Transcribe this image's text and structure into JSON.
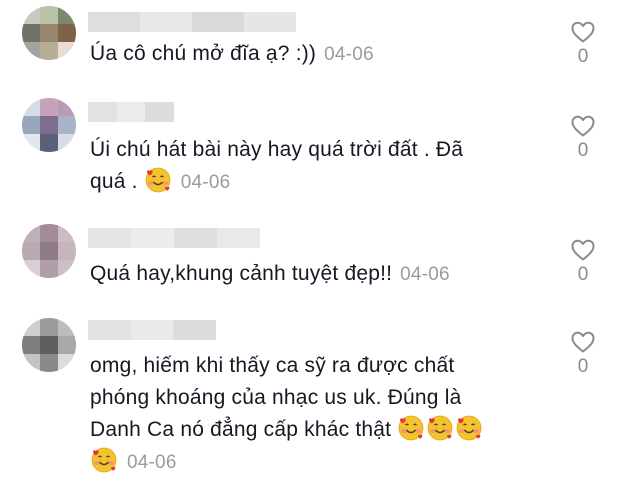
{
  "comments": [
    {
      "text": "Úa cô chú mở đĩa ạ? :))",
      "date": "04-06",
      "likes": "0",
      "emoji_count": 0,
      "avatar_colors": [
        "#c9c9c1",
        "#b9c3a5",
        "#7a8a6a",
        "#6f7468",
        "#98856d",
        "#7e6348",
        "#a3a3a0",
        "#b7ae96",
        "#e6dccf"
      ]
    },
    {
      "text": "Úi chú hát bài này hay quá trời đất . Đã",
      "text2": "quá .",
      "date": "04-06",
      "likes": "0",
      "emoji_count": 1,
      "avatar_colors": [
        "#d7dbe8",
        "#c7a3bb",
        "#b89bb4",
        "#9aa7bb",
        "#7c6e8c",
        "#a9b2c6",
        "#e4e6ef",
        "#5a6078",
        "#d9dbe5"
      ]
    },
    {
      "text": "Quá hay,khung cảnh tuyệt đẹp!!",
      "date": "04-06",
      "likes": "0",
      "emoji_count": 0,
      "avatar_colors": [
        "#bfb0b7",
        "#a48b98",
        "#c9bcc4",
        "#b8a9b2",
        "#8f7a87",
        "#c6b5bd",
        "#d9cfd4",
        "#b19ea8",
        "#cdbfc6"
      ]
    },
    {
      "text": "omg, hiếm khi thấy ca sỹ ra được chất",
      "text2": "phóng khoáng của nhạc us uk. Đúng là",
      "text3": "Danh Ca nó đẳng cấp khác thật",
      "date": "04-06",
      "likes": "0",
      "emoji_count": 4,
      "avatar_colors": [
        "#cfcfcf",
        "#9b9b9b",
        "#bdbdbd",
        "#7d7d7d",
        "#5e5e5e",
        "#a8a8a8",
        "#c4c4c4",
        "#8a8a8a",
        "#dcdcdc"
      ]
    }
  ],
  "colors": {
    "text": "#161823",
    "muted": "#9a9ba0",
    "heart_outline": "#8a8b91"
  },
  "icons": {
    "like": "heart-outline-icon",
    "emoji": "smiling-face-with-hearts-emoji"
  }
}
